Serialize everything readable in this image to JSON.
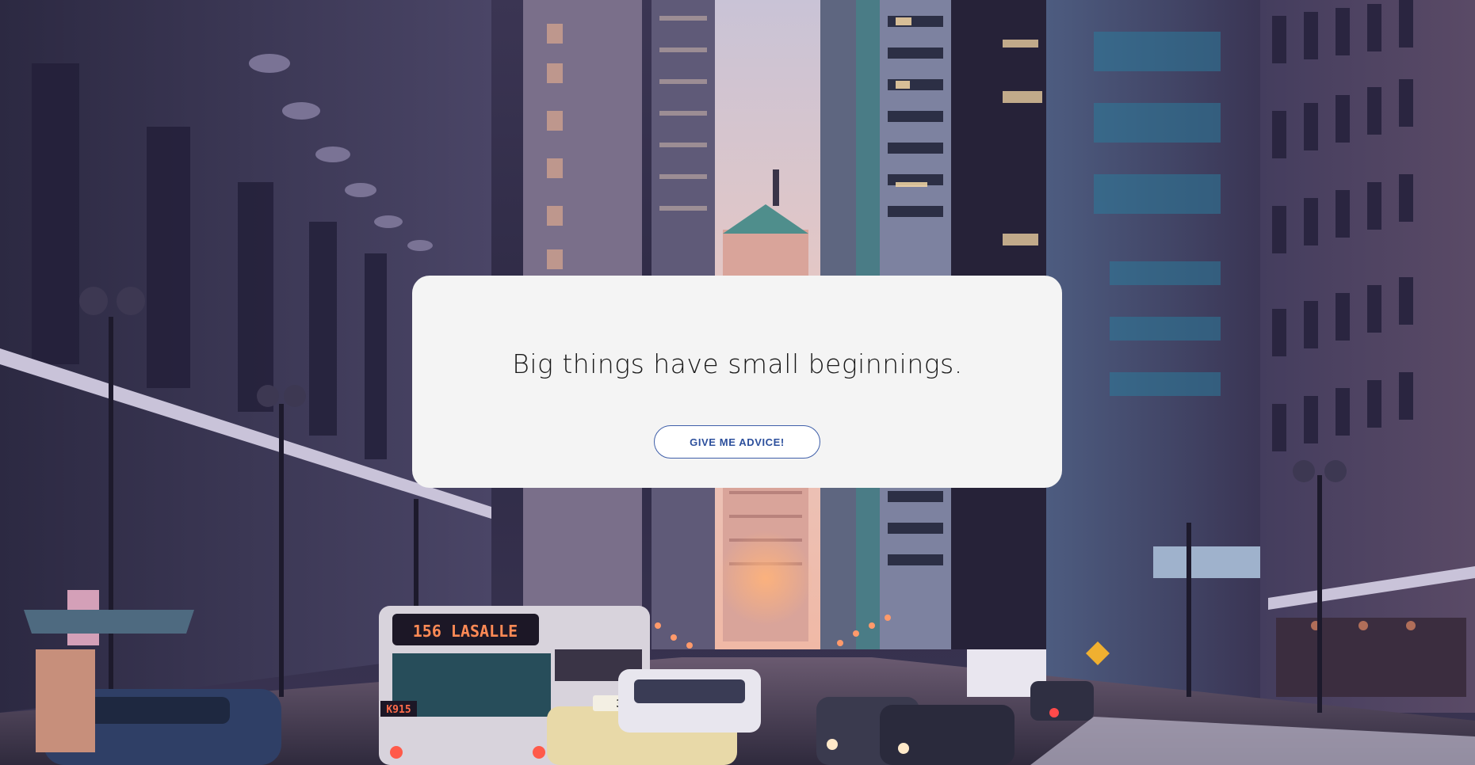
{
  "hero": {
    "headline": "Big things have small beginnings.",
    "button_label": "GIVE ME ADVICE!"
  },
  "background": {
    "signs": {
      "bus_route": "156 LASALLE",
      "bus_number": "K915",
      "taxi_number": "3270"
    }
  },
  "colors": {
    "card": "#f4f4f4",
    "button_border": "#3f5fa9",
    "button_text": "#2c4f9c",
    "headline": "#1a1a1a"
  }
}
